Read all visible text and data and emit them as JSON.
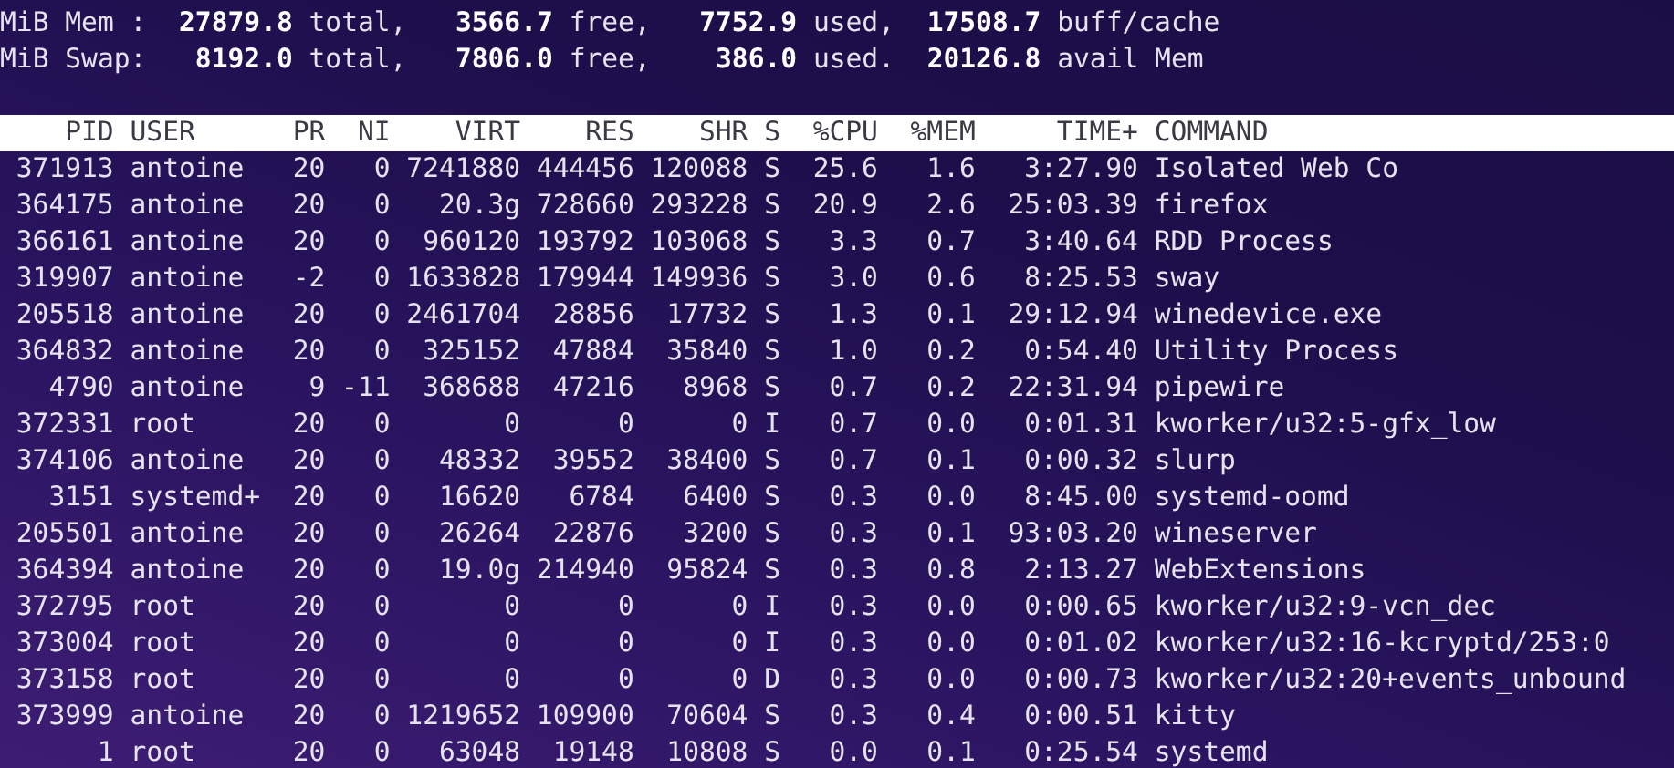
{
  "memory_lines": [
    "MiB Mem :  **27879.8** total,   **3566.7** free,   **7752.9** used,  **17508.7** buff/cache",
    "MiB Swap:   **8192.0** total,   **7806.0** free,    **386.0** used.  **20126.8** avail Mem"
  ],
  "table": {
    "columns": [
      "PID",
      "USER",
      "PR",
      "NI",
      "VIRT",
      "RES",
      "SHR",
      "S",
      "%CPU",
      "%MEM",
      "TIME+",
      "COMMAND"
    ],
    "rows": [
      [
        "371913",
        "antoine",
        "20",
        "0",
        "7241880",
        "444456",
        "120088",
        "S",
        "25.6",
        "1.6",
        "3:27.90",
        "Isolated Web Co"
      ],
      [
        "364175",
        "antoine",
        "20",
        "0",
        "20.3g",
        "728660",
        "293228",
        "S",
        "20.9",
        "2.6",
        "25:03.39",
        "firefox"
      ],
      [
        "366161",
        "antoine",
        "20",
        "0",
        "960120",
        "193792",
        "103068",
        "S",
        "3.3",
        "0.7",
        "3:40.64",
        "RDD Process"
      ],
      [
        "319907",
        "antoine",
        "-2",
        "0",
        "1633828",
        "179944",
        "149936",
        "S",
        "3.0",
        "0.6",
        "8:25.53",
        "sway"
      ],
      [
        "205518",
        "antoine",
        "20",
        "0",
        "2461704",
        "28856",
        "17732",
        "S",
        "1.3",
        "0.1",
        "29:12.94",
        "winedevice.exe"
      ],
      [
        "364832",
        "antoine",
        "20",
        "0",
        "325152",
        "47884",
        "35840",
        "S",
        "1.0",
        "0.2",
        "0:54.40",
        "Utility Process"
      ],
      [
        "4790",
        "antoine",
        "9",
        "-11",
        "368688",
        "47216",
        "8968",
        "S",
        "0.7",
        "0.2",
        "22:31.94",
        "pipewire"
      ],
      [
        "372331",
        "root",
        "20",
        "0",
        "0",
        "0",
        "0",
        "I",
        "0.7",
        "0.0",
        "0:01.31",
        "kworker/u32:5-gfx_low"
      ],
      [
        "374106",
        "antoine",
        "20",
        "0",
        "48332",
        "39552",
        "38400",
        "S",
        "0.7",
        "0.1",
        "0:00.32",
        "slurp"
      ],
      [
        "3151",
        "systemd+",
        "20",
        "0",
        "16620",
        "6784",
        "6400",
        "S",
        "0.3",
        "0.0",
        "8:45.00",
        "systemd-oomd"
      ],
      [
        "205501",
        "antoine",
        "20",
        "0",
        "26264",
        "22876",
        "3200",
        "S",
        "0.3",
        "0.1",
        "93:03.20",
        "wineserver"
      ],
      [
        "364394",
        "antoine",
        "20",
        "0",
        "19.0g",
        "214940",
        "95824",
        "S",
        "0.3",
        "0.8",
        "2:13.27",
        "WebExtensions"
      ],
      [
        "372795",
        "root",
        "20",
        "0",
        "0",
        "0",
        "0",
        "I",
        "0.3",
        "0.0",
        "0:00.65",
        "kworker/u32:9-vcn_dec"
      ],
      [
        "373004",
        "root",
        "20",
        "0",
        "0",
        "0",
        "0",
        "I",
        "0.3",
        "0.0",
        "0:01.02",
        "kworker/u32:16-kcryptd/253:0"
      ],
      [
        "373158",
        "root",
        "20",
        "0",
        "0",
        "0",
        "0",
        "D",
        "0.3",
        "0.0",
        "0:00.73",
        "kworker/u32:20+events_unbound"
      ],
      [
        "373999",
        "antoine",
        "20",
        "0",
        "1219652",
        "109900",
        "70604",
        "S",
        "0.3",
        "0.4",
        "0:00.51",
        "kitty"
      ],
      [
        "1",
        "root",
        "20",
        "0",
        "63048",
        "19148",
        "10808",
        "S",
        "0.0",
        "0.1",
        "0:25.54",
        "systemd"
      ]
    ]
  }
}
